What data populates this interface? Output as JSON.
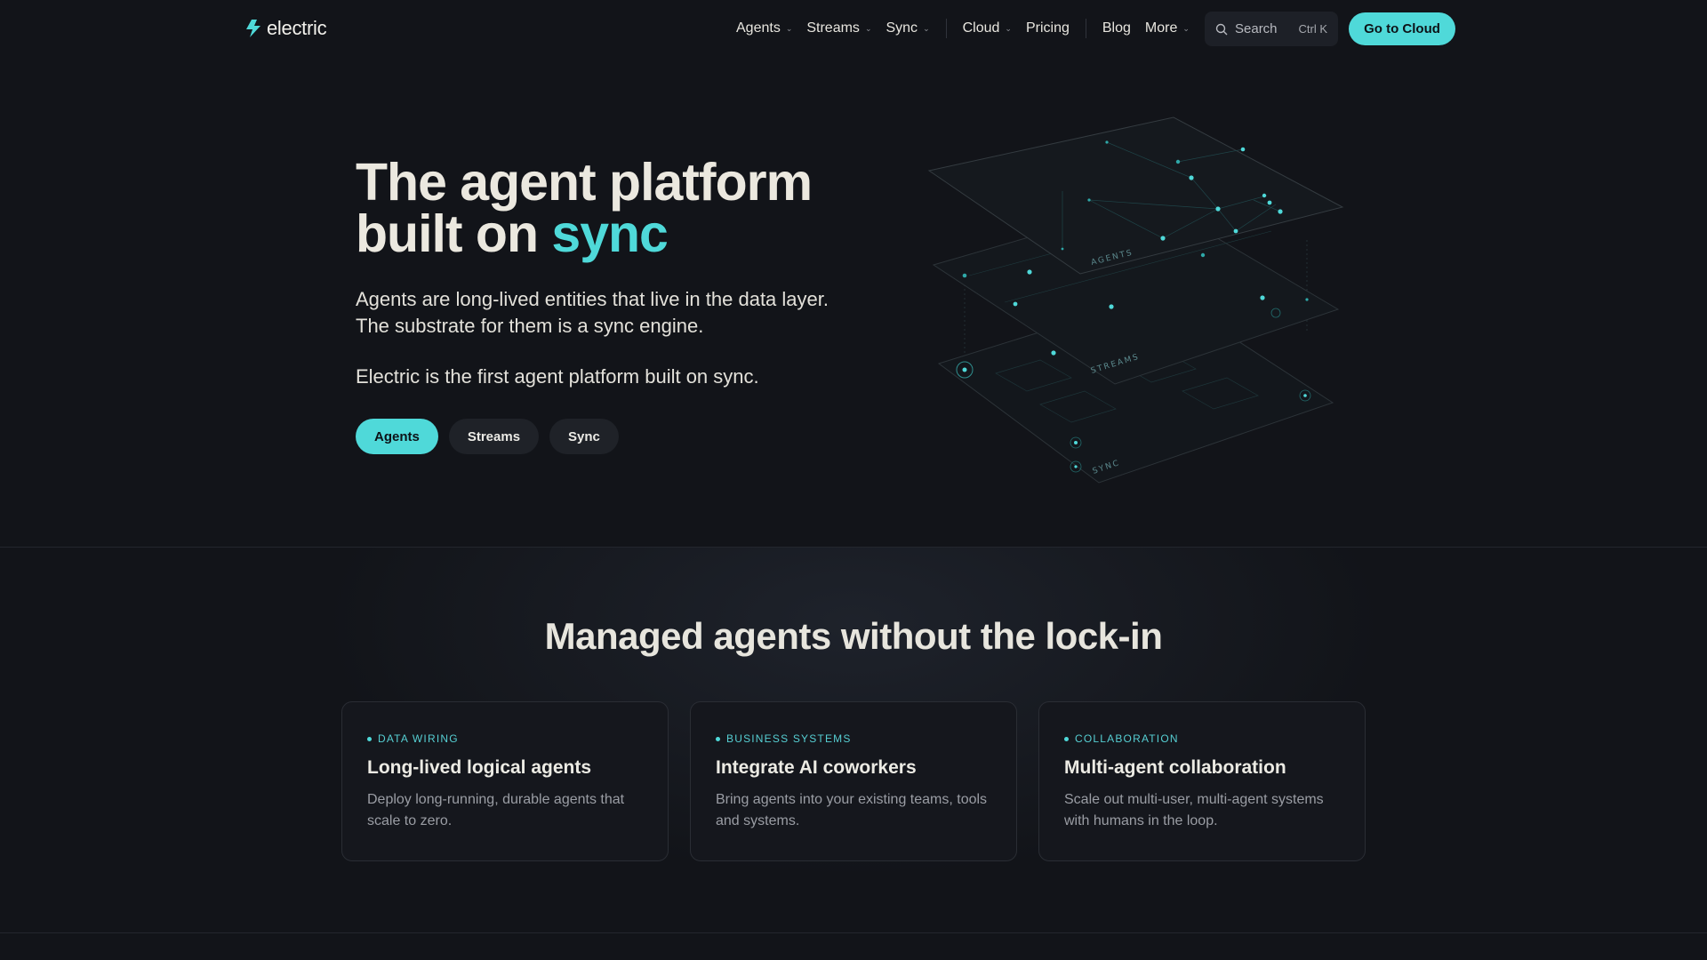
{
  "nav": {
    "logo_text": "electric",
    "items": [
      {
        "label": "Agents",
        "has_menu": true
      },
      {
        "label": "Streams",
        "has_menu": true
      },
      {
        "label": "Sync",
        "has_menu": true
      },
      {
        "label": "Cloud",
        "has_menu": true
      },
      {
        "label": "Pricing",
        "has_menu": false
      },
      {
        "label": "Blog",
        "has_menu": false
      },
      {
        "label": "More",
        "has_menu": true
      }
    ],
    "search_label": "Search",
    "search_shortcut": "Ctrl K",
    "cta_label": "Go to Cloud"
  },
  "hero": {
    "title_line1": "The agent platform",
    "title_line2_prefix": "built on ",
    "title_accent": "sync",
    "subtitle_line1": "Agents are long-lived entities that live in the data layer.",
    "subtitle_line2": "The substrate for them is a sync engine.",
    "subtitle_line3": "Electric is the first agent platform built on sync.",
    "pills": [
      {
        "label": "Agents",
        "active": true
      },
      {
        "label": "Streams",
        "active": false
      },
      {
        "label": "Sync",
        "active": false
      }
    ],
    "layer_labels": [
      "AGENTS",
      "STREAMS",
      "SYNC"
    ]
  },
  "section": {
    "title": "Managed agents without the lock-in",
    "cards": [
      {
        "tag": "DATA WIRING",
        "title": "Long-lived logical agents",
        "description": "Deploy long-running, durable agents that scale to zero."
      },
      {
        "tag": "BUSINESS SYSTEMS",
        "title": "Integrate AI coworkers",
        "description": "Bring agents into your existing teams, tools and systems."
      },
      {
        "tag": "COLLABORATION",
        "title": "Multi-agent collaboration",
        "description": "Scale out multi-user, multi-agent systems with humans in the loop."
      }
    ]
  },
  "colors": {
    "background": "#121419",
    "accent": "#4fd9d9",
    "text": "#ebe8df",
    "muted": "#9a9da4"
  },
  "icons": [
    "electric-bolt-icon",
    "chevron-down-icon",
    "search-icon"
  ]
}
